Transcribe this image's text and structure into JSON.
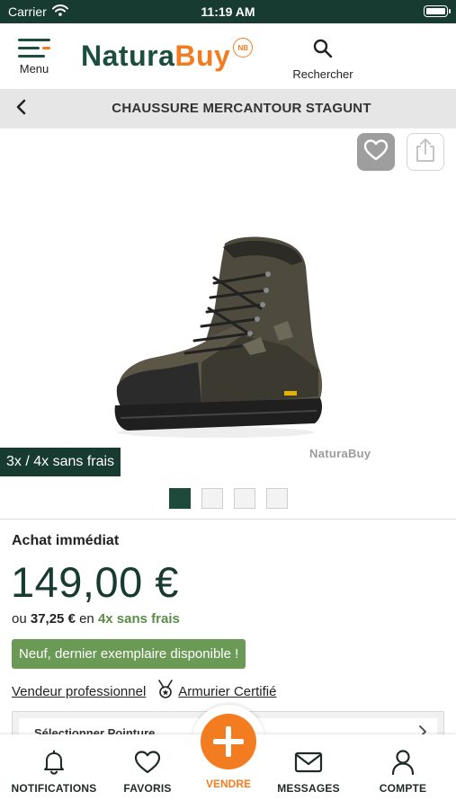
{
  "status_bar": {
    "carrier": "Carrier",
    "time": "11:19 AM"
  },
  "header": {
    "menu_label": "Menu",
    "logo_natura": "Natura",
    "logo_buy": "Buy",
    "logo_badge": "NB",
    "search_label": "Rechercher"
  },
  "title_bar": {
    "title": "CHAUSSURE MERCANTOUR STAGUNT"
  },
  "gallery": {
    "watermark": "NaturaBuy",
    "installment_tag": "3x / 4x sans frais",
    "image_count": 4,
    "active_index": 0
  },
  "details": {
    "purchase_label": "Achat immédiat",
    "price": "149,00 €",
    "installment_prefix": "ou",
    "installment_amount": "37,25 €",
    "installment_middle": "en",
    "installment_plan": "4x sans frais",
    "availability": "Neuf, dernier exemplaire disponible !",
    "seller_type": "Vendeur professionnel",
    "certification": "Armurier Certifié",
    "size_select_label": "Sélectionner Pointure"
  },
  "tab_bar": {
    "notifications": "NOTIFICATIONS",
    "favorites": "FAVORIS",
    "sell": "VENDRE",
    "messages": "MESSAGES",
    "account": "COMPTE"
  },
  "colors": {
    "dark_green": "#173a31",
    "brand_orange": "#f37c20",
    "availability_green": "#6b9a56"
  },
  "icons": [
    "wifi-icon",
    "battery-icon",
    "menu-icon",
    "search-icon",
    "back-chevron-icon",
    "heart-icon",
    "share-icon",
    "medal-icon",
    "chevron-right-icon",
    "bell-icon",
    "plus-icon",
    "envelope-icon",
    "person-icon"
  ]
}
